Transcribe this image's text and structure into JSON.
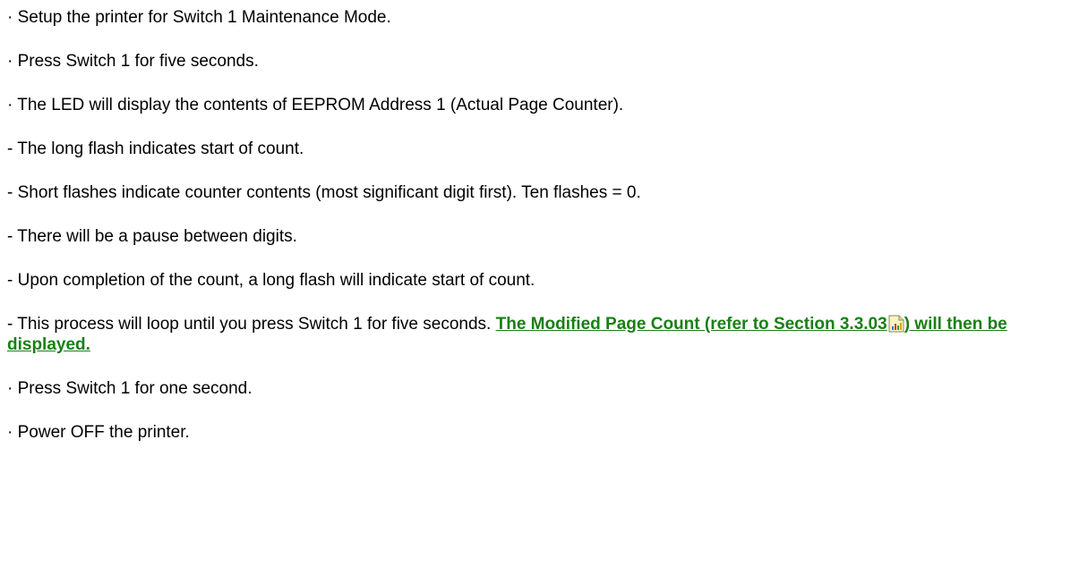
{
  "steps": [
    "· Setup the printer for Switch 1 Maintenance Mode.",
    "· Press Switch 1 for five seconds.",
    "· The LED will display the contents of EEPROM Address 1 (Actual Page Counter).",
    "- The long flash indicates start of count.",
    "- Short flashes indicate counter contents (most significant digit first). Ten flashes = 0.",
    "- There will be a pause between digits.",
    "- Upon completion of the count, a long flash will indicate start of count.",
    "- This process will loop until you press Switch 1 for five seconds. ",
    "· Press Switch 1 for one second.",
    "· Power OFF the printer."
  ],
  "link": {
    "part1": "The Modified Page Count (refer to Section 3.3.03",
    "part2": ") will then be displayed.",
    "color": "#1a7f16",
    "icon": "document-chart-icon"
  }
}
